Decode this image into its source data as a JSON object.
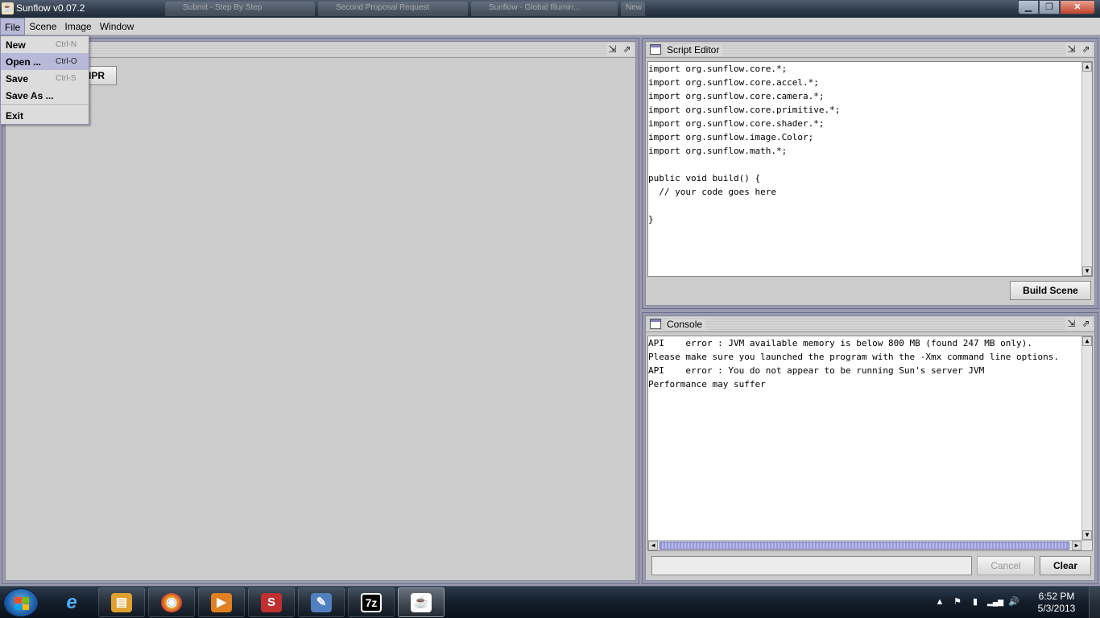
{
  "window": {
    "title": "Sunflow v0.07.2",
    "background_tabs": [
      "Submit - Step By Step",
      "Second Proposal Request",
      "Sunflow - Global Illumin...",
      "New"
    ],
    "controls": {
      "minimize": "▁",
      "maximize": "❐",
      "close": "✕"
    }
  },
  "menubar": {
    "items": [
      "File",
      "Scene",
      "Image",
      "Window"
    ]
  },
  "file_menu": {
    "items": [
      {
        "label": "New",
        "accel": "Ctrl-N"
      },
      {
        "label": "Open ...",
        "accel": "Ctrl-O"
      },
      {
        "label": "Save",
        "accel": "Ctrl-S"
      },
      {
        "label": "Save As ...",
        "accel": ""
      },
      {
        "label": "Exit",
        "accel": ""
      }
    ],
    "highlighted": "Open ..."
  },
  "render_frame": {
    "title": "",
    "ipr_button": "IPR",
    "minimize_glyph": "⇲",
    "maximize_glyph": "⇗"
  },
  "script_editor": {
    "title": "Script Editor",
    "lines": [
      "import org.sunflow.core.*;",
      "import org.sunflow.core.accel.*;",
      "import org.sunflow.core.camera.*;",
      "import org.sunflow.core.primitive.*;",
      "import org.sunflow.core.shader.*;",
      "import org.sunflow.image.Color;",
      "import org.sunflow.math.*;",
      "",
      "public void build() {",
      "  // your code goes here",
      "",
      "}"
    ],
    "build_button": "Build Scene",
    "minimize_glyph": "⇲",
    "maximize_glyph": "⇗"
  },
  "console": {
    "title": "Console",
    "lines": [
      "API    error : JVM available memory is below 800 MB (found 247 MB only).",
      "Please make sure you launched the program with the -Xmx command line options.",
      "API    error : You do not appear to be running Sun's server JVM",
      "Performance may suffer"
    ],
    "input_value": "",
    "cancel_button": "Cancel",
    "clear_button": "Clear",
    "minimize_glyph": "⇲",
    "maximize_glyph": "⇗"
  },
  "taskbar": {
    "apps": [
      {
        "name": "Internet Explorer",
        "glyph": "e",
        "color": "#1e88e5"
      },
      {
        "name": "Windows Explorer",
        "glyph": "▤",
        "color": "#e0a030"
      },
      {
        "name": "Google Chrome",
        "glyph": "◉",
        "color": "#d04030"
      },
      {
        "name": "Media Player",
        "glyph": "▶",
        "color": "#e08020"
      },
      {
        "name": "SketchUp",
        "glyph": "S",
        "color": "#c03030"
      },
      {
        "name": "Paint",
        "glyph": "✎",
        "color": "#5080c0"
      },
      {
        "name": "7-Zip",
        "glyph": "7z",
        "color": "#000000"
      },
      {
        "name": "Java",
        "glyph": "☕",
        "color": "#e05020"
      }
    ],
    "tray_icons": [
      "▲",
      "⚑",
      "▮",
      "▂▄▆",
      "🔊"
    ],
    "time": "6:52 PM",
    "date": "5/3/2013"
  }
}
